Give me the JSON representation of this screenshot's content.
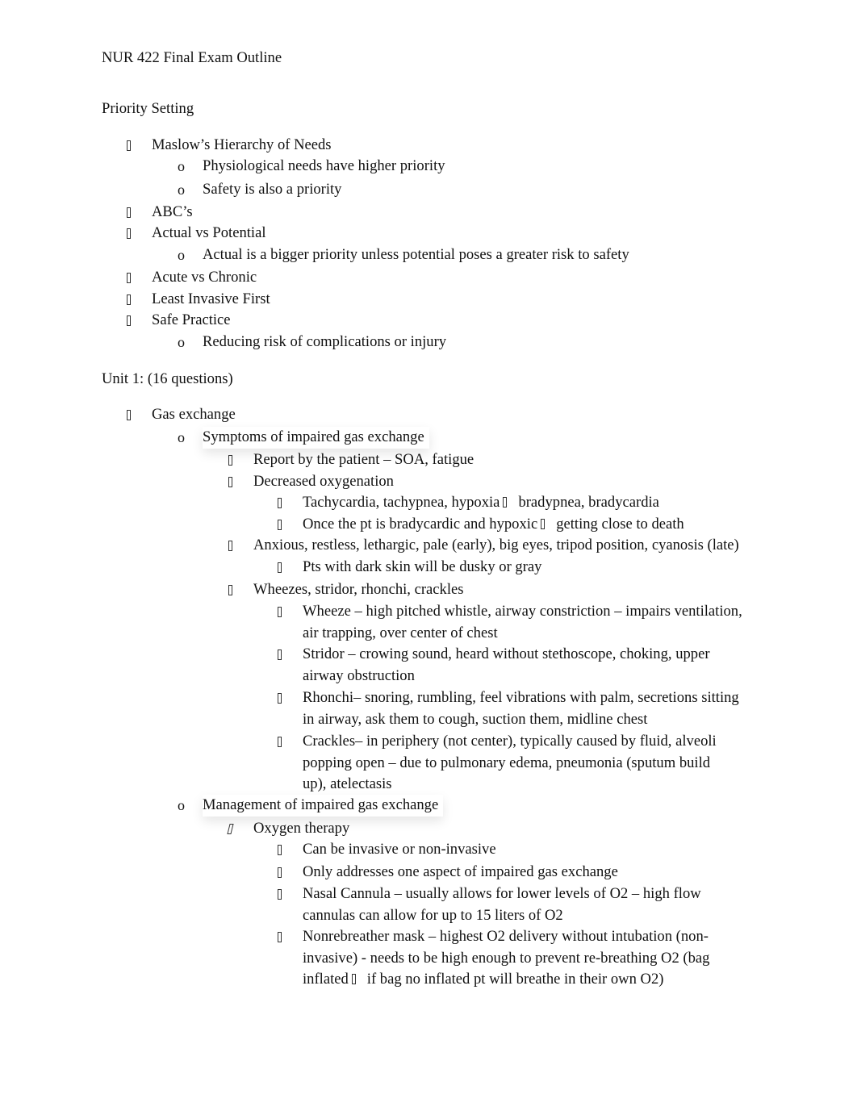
{
  "document": {
    "title": "NUR 422 Final Exam Outline",
    "sections": [
      {
        "heading": "Priority Setting",
        "items": [
          {
            "text": "Maslow’s Hierarchy of Needs",
            "bullet": "box-glyph"
          },
          {
            "text": "Physiological needs have higher priority",
            "bullet": "o"
          },
          {
            "text": "Safety is also a priority",
            "bullet": "o"
          },
          {
            "text": "ABC’s",
            "bullet": "box-glyph"
          },
          {
            "text": "Actual vs Potential",
            "bullet": "box-glyph"
          },
          {
            "text": "Actual is a bigger priority unless potential poses a greater risk to safety",
            "bullet": "o"
          },
          {
            "text": "Acute vs Chronic",
            "bullet": "box-glyph"
          },
          {
            "text": "Least Invasive First",
            "bullet": "box-glyph"
          },
          {
            "text": "Safe Practice",
            "bullet": "box-glyph"
          },
          {
            "text": "Reducing risk of complications or injury",
            "bullet": "o"
          }
        ]
      },
      {
        "heading": "Unit 1: (16 questions)",
        "items": [
          {
            "text": "Gas exchange",
            "bullet": "box-glyph"
          },
          {
            "text": "Symptoms of impaired gas exchange",
            "bullet": "o"
          },
          {
            "text": "Report by the patient – SOA, fatigue",
            "bullet": "box-glyph"
          },
          {
            "text": "Decreased oxygenation",
            "bullet": "box-glyph"
          },
          {
            "text_before": "Tachycardia, tachypnea, hypoxia",
            "text_after": "bradypnea, bradycardia",
            "inline_icon": "arrow-right-icon",
            "bullet": "box-glyph"
          },
          {
            "text_before": "Once the pt is bradycardic and hypoxic",
            "text_after": "getting close to death",
            "inline_icon": "arrow-right-icon",
            "bullet": "box-glyph"
          },
          {
            "text": "Anxious, restless, lethargic, pale (early), big eyes, tripod position, cyanosis (late)",
            "bullet": "box-glyph"
          },
          {
            "text": "Pts with dark skin will be dusky or gray",
            "bullet": "box-glyph"
          },
          {
            "text": "Wheezes, stridor, rhonchi, crackles",
            "bullet": "box-glyph"
          },
          {
            "lines": [
              "Wheeze – high pitched whistle, airway constriction – impairs ventilation,",
              "air trapping, over center of chest"
            ],
            "bullet": "box-glyph"
          },
          {
            "lines": [
              "Stridor – crowing sound, heard without stethoscope, choking, upper",
              "airway obstruction"
            ],
            "bullet": "box-glyph"
          },
          {
            "lines": [
              "Rhonchi– snoring, rumbling, feel vibrations with palm, secretions sitting",
              "in airway, ask them to cough, suction them, midline chest"
            ],
            "bullet": "box-glyph"
          },
          {
            "lines": [
              "Crackles– in periphery (not center), typically caused by fluid, alveoli",
              "popping open – due to pulmonary edema, pneumonia (sputum build",
              "up), atelectasis"
            ],
            "bullet": "box-glyph"
          },
          {
            "text": "Management of impaired gas exchange",
            "bullet": "o"
          },
          {
            "text": "Oxygen therapy",
            "bullet": "box-glyph-italic"
          },
          {
            "text": "Can be invasive or non-invasive",
            "bullet": "box-glyph"
          },
          {
            "text": "Only addresses one aspect of impaired gas exchange",
            "bullet": "box-glyph"
          },
          {
            "lines": [
              "Nasal Cannula – usually allows for lower levels of O2 – high flow",
              "cannulas can allow for up to 15 liters of O2"
            ],
            "bullet": "box-glyph"
          },
          {
            "lines": [
              "Nonrebreather mask – highest O2 delivery without intubation (non-",
              "invasive) - needs to be high enough to prevent re-breathing O2 (bag"
            ],
            "last_line_before": "inflated",
            "last_line_after": "if bag no inflated pt will breathe in their own O2)",
            "inline_icon": "arrow-right-icon",
            "bullet": "box-glyph"
          }
        ]
      }
    ]
  }
}
